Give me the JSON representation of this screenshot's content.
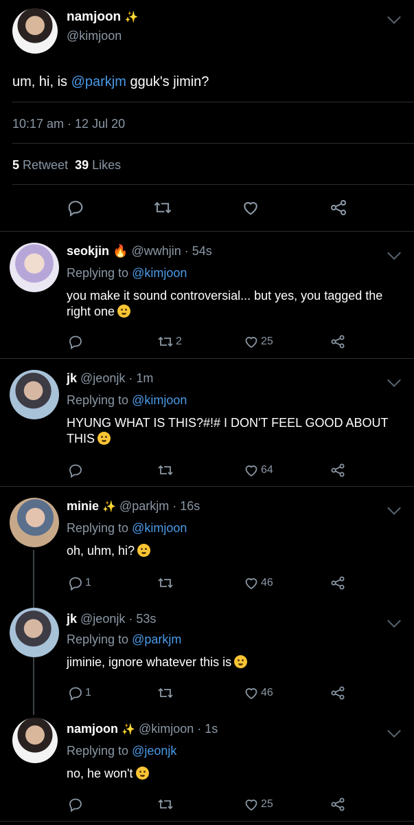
{
  "main": {
    "name": "namjoon",
    "sparkle": "✨",
    "handle": "@kimjoon",
    "text_prefix": "um, hi, is ",
    "mention": "@parkjm",
    "text_suffix": " gguk's jimin?",
    "time": "10:17 am · 12 Jul 20",
    "retweet_count": "5",
    "retweet_label": "Retweet",
    "like_count": "39",
    "like_label": "Likes"
  },
  "replies": [
    {
      "name": "seokjin",
      "badge": "🔥",
      "handle": "@wwhjin",
      "time": "54s",
      "replying_label": "Replying to",
      "replying_to": "@kimjoon",
      "text": "you make it sound controversial... but yes, you tagged the right one",
      "reply_count": "",
      "retweet_count": "2",
      "like_count": "25"
    },
    {
      "name": "jk",
      "badge": "",
      "handle": "@jeonjk",
      "time": "1m",
      "replying_label": "Replying to",
      "replying_to": "@kimjoon",
      "text": "HYUNG WHAT IS THIS?#!# I DON'T FEEL GOOD ABOUT THIS",
      "reply_count": "",
      "retweet_count": "",
      "like_count": "64"
    },
    {
      "name": "minie",
      "badge": "✨",
      "handle": "@parkjm",
      "time": "16s",
      "replying_label": "Replying to",
      "replying_to": "@kimjoon",
      "text": "oh, uhm, hi?",
      "reply_count": "1",
      "retweet_count": "",
      "like_count": "46"
    },
    {
      "name": "jk",
      "badge": "",
      "handle": "@jeonjk",
      "time": "53s",
      "replying_label": "Replying to",
      "replying_to": "@parkjm",
      "text": "jiminie, ignore whatever this is",
      "reply_count": "1",
      "retweet_count": "",
      "like_count": "46"
    },
    {
      "name": "namjoon",
      "badge": "✨",
      "handle": "@kimjoon",
      "time": "1s",
      "replying_label": "Replying to",
      "replying_to": "@jeonjk",
      "text": "no, he won't",
      "reply_count": "",
      "retweet_count": "",
      "like_count": "25"
    }
  ],
  "colors": {
    "background": "#000000",
    "link": "#4a9ae8",
    "muted": "#8b98a5",
    "divider": "#2a2f33"
  }
}
